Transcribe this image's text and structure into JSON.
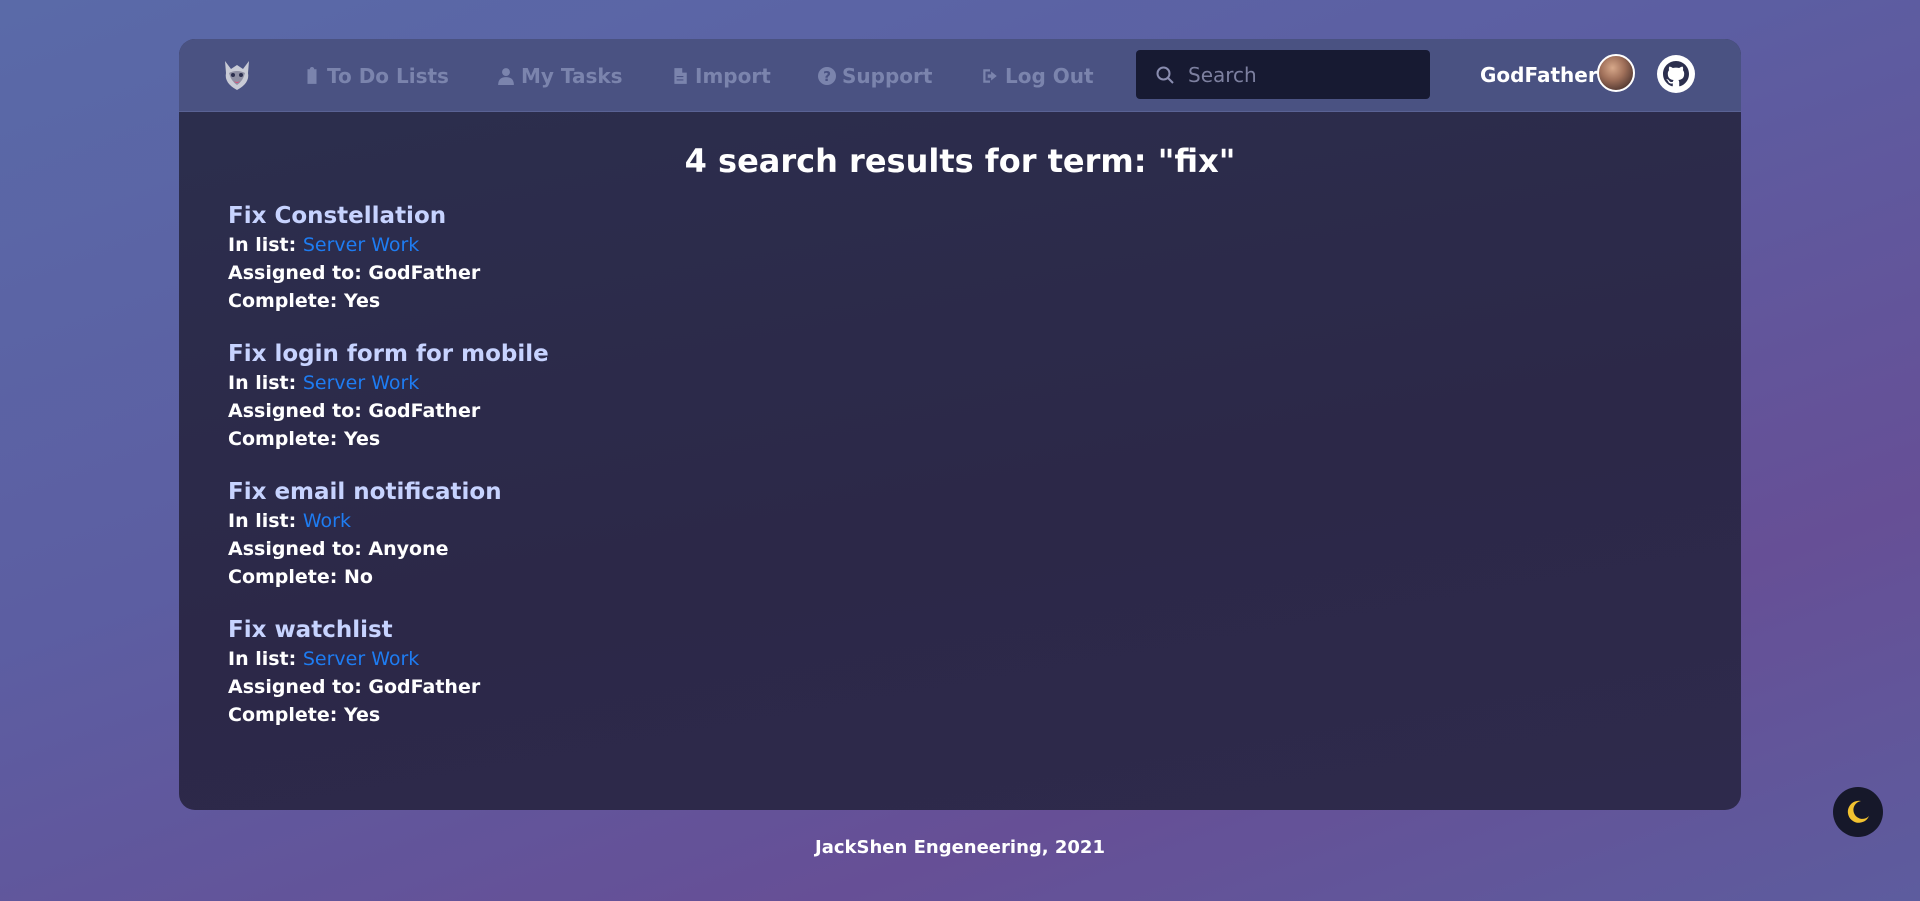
{
  "nav": {
    "items": [
      {
        "label": "To Do Lists",
        "icon": "clipboard-icon"
      },
      {
        "label": "My Tasks",
        "icon": "user-icon"
      },
      {
        "label": "Import",
        "icon": "file-icon"
      },
      {
        "label": "Support",
        "icon": "question-circle-icon"
      },
      {
        "label": "Log Out",
        "icon": "sign-out-icon"
      }
    ],
    "search_placeholder": "Search",
    "username": "GodFather"
  },
  "main": {
    "heading": "4 search results for term: \"fix\"",
    "in_list_label": "In list: ",
    "results": [
      {
        "title": "Fix Constellation",
        "list": "Server Work",
        "assigned": "Assigned to: GodFather",
        "complete": "Complete: Yes"
      },
      {
        "title": "Fix login form for mobile",
        "list": "Server Work",
        "assigned": "Assigned to: GodFather",
        "complete": "Complete: Yes"
      },
      {
        "title": "Fix email notification",
        "list": "Work",
        "assigned": "Assigned to: Anyone",
        "complete": "Complete: No"
      },
      {
        "title": "Fix watchlist",
        "list": "Server Work",
        "assigned": "Assigned to: GodFather",
        "complete": "Complete: Yes"
      }
    ]
  },
  "footer": {
    "text": "JackShen Engeneering, 2021"
  },
  "theme": {
    "icon": "moon-icon",
    "accent": "#f2c230"
  },
  "colors": {
    "link": "#1e7cf2",
    "result_title": "#c7d3ff",
    "nav_text": "#7b84ad"
  }
}
